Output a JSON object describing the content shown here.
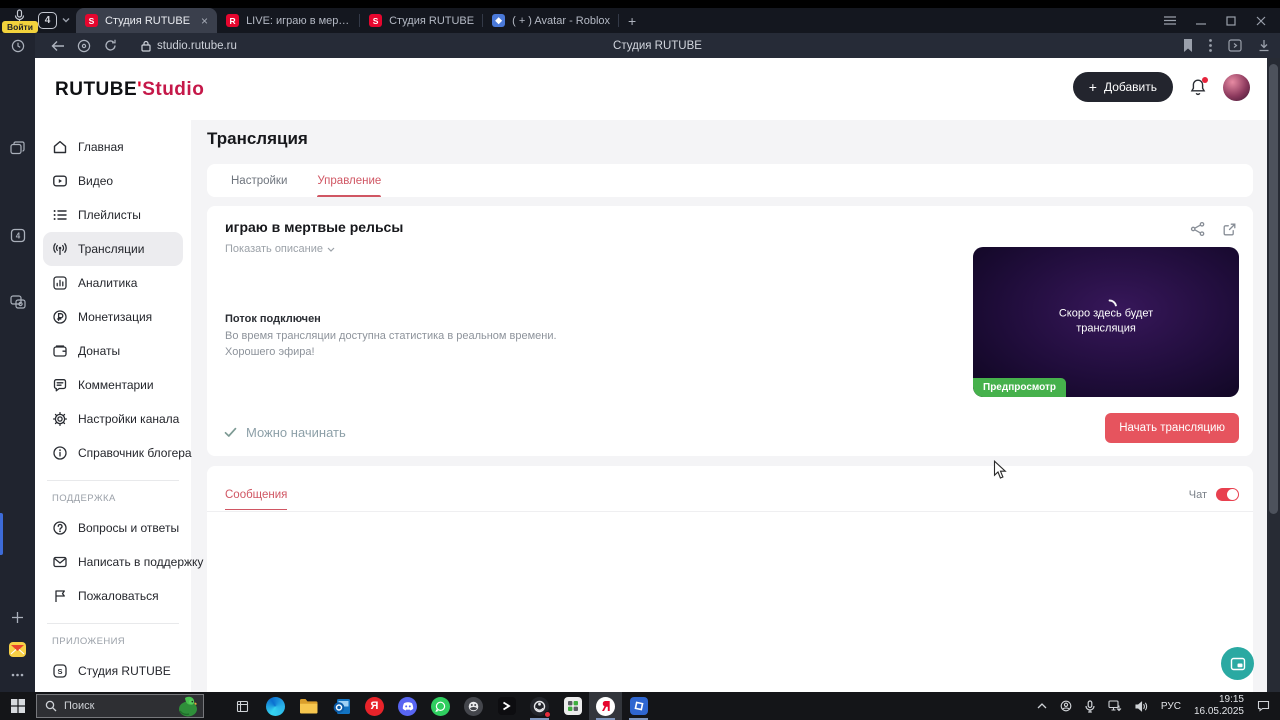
{
  "browser": {
    "signin_label": "Войти",
    "tab_counter": "4",
    "tabs": [
      {
        "title": "Студия RUTUBE",
        "icon": "rutube-studio-favicon"
      },
      {
        "title": "LIVE: играю в мертвые ре",
        "icon": "rutube-favicon"
      },
      {
        "title": "Студия RUTUBE",
        "icon": "rutube-studio-favicon"
      },
      {
        "title": "( + ) Avatar - Roblox",
        "icon": "roblox-favicon"
      }
    ],
    "url": "studio.rutube.ru",
    "window_page_title": "Студия RUTUBE"
  },
  "studio": {
    "logo_primary": "RUTUBE",
    "logo_secondary": "Studio",
    "add_button_label": "Добавить",
    "page_title": "Трансляция",
    "content_tabs": [
      {
        "label": "Настройки"
      },
      {
        "label": "Управление"
      }
    ],
    "sidebar": {
      "items": [
        {
          "label": "Главная",
          "icon": "home-icon"
        },
        {
          "label": "Видео",
          "icon": "video-icon"
        },
        {
          "label": "Плейлисты",
          "icon": "playlist-icon"
        },
        {
          "label": "Трансляции",
          "icon": "broadcast-icon"
        },
        {
          "label": "Аналитика",
          "icon": "analytics-icon"
        },
        {
          "label": "Монетизация",
          "icon": "monetization-icon"
        },
        {
          "label": "Донаты",
          "icon": "donations-icon"
        },
        {
          "label": "Комментарии",
          "icon": "comments-icon"
        },
        {
          "label": "Настройки канала",
          "icon": "gear-icon"
        },
        {
          "label": "Справочник блогера",
          "icon": "info-icon"
        }
      ],
      "support_header": "ПОДДЕРЖКА",
      "support_items": [
        {
          "label": "Вопросы и ответы",
          "icon": "question-icon"
        },
        {
          "label": "Написать в поддержку",
          "icon": "mail-icon"
        },
        {
          "label": "Пожаловаться",
          "icon": "flag-icon"
        }
      ],
      "apps_header": "ПРИЛОЖЕНИЯ",
      "app_items": [
        {
          "label": "Студия RUTUBE",
          "icon": "rutube-studio-app-icon"
        }
      ]
    },
    "stream": {
      "title": "играю в мертвые рельсы",
      "show_description_label": "Показать описание",
      "status_title": "Поток подключен",
      "status_line_1": "Во время трансляции доступна статистика в реальном времени.",
      "status_line_2": "Хорошего эфира!",
      "preview_placeholder": "Скоро здесь будет трансляция",
      "preview_badge": "Предпросмотр",
      "ready_label": "Можно начинать",
      "start_button_label": "Начать трансляцию"
    },
    "messages": {
      "tab_label": "Сообщения",
      "chat_label": "Чат",
      "chat_toggle_on": true
    },
    "colors": {
      "brand_red": "#c51849",
      "accent_red": "#d05663",
      "start_button_red": "#e6545e",
      "badge_green": "#46b14c",
      "toggle_red": "#e8404f",
      "fab_teal": "#2aa9a2"
    }
  },
  "taskbar": {
    "search_placeholder": "Поиск",
    "language": "РУС",
    "time": "19:15",
    "date": "16.05.2025"
  }
}
